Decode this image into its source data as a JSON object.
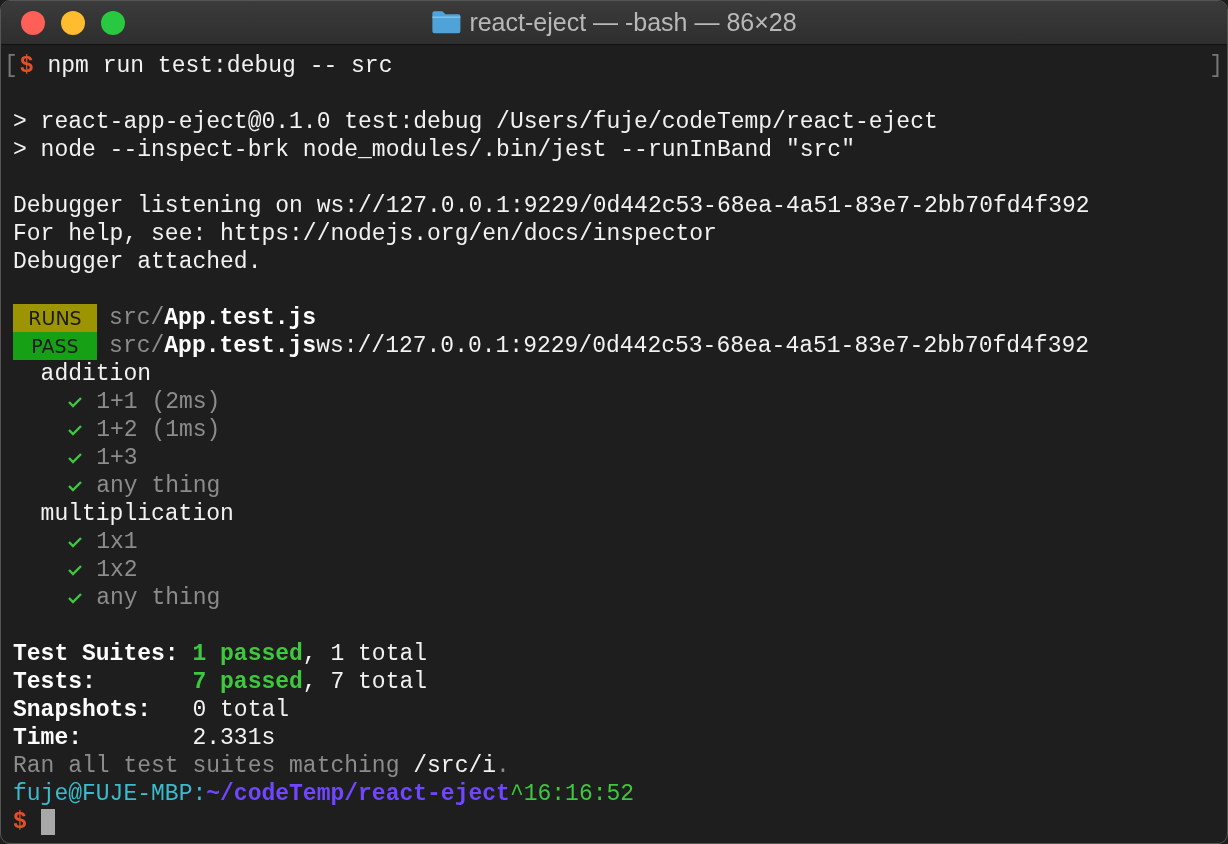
{
  "window": {
    "title": "react-eject — -bash — 86×28"
  },
  "terminal": {
    "lines": [
      {
        "kind": "text",
        "segments": [
          {
            "kind": "edge",
            "text": "["
          },
          {
            "kind": "prompt",
            "text": "$"
          },
          {
            "kind": "plain",
            "text": "npm run test:debug -- src"
          },
          {
            "kind": "edge-right",
            "text": "]"
          }
        ]
      },
      {
        "kind": "blank"
      },
      {
        "kind": "text",
        "segments": [
          {
            "kind": "plain",
            "text": "> react-app-eject@0.1.0 test:debug /Users/fuje/codeTemp/react-eject"
          }
        ]
      },
      {
        "kind": "text",
        "segments": [
          {
            "kind": "plain",
            "text": "> node --inspect-brk node_modules/.bin/jest --runInBand \"src\""
          }
        ]
      },
      {
        "kind": "blank"
      },
      {
        "kind": "text",
        "segments": [
          {
            "kind": "plain",
            "text": "Debugger listening on ws://127.0.0.1:9229/0d442c53-68ea-4a51-83e7-2bb70fd4f392"
          }
        ]
      },
      {
        "kind": "text",
        "segments": [
          {
            "kind": "plain",
            "text": "For help, see: https://nodejs.org/en/docs/inspector"
          }
        ]
      },
      {
        "kind": "text",
        "segments": [
          {
            "kind": "plain",
            "text": "Debugger attached."
          }
        ]
      },
      {
        "kind": "blank"
      },
      {
        "kind": "badge",
        "badge": "RUNS",
        "color": "#9c9400",
        "segments": [
          {
            "kind": "dim",
            "text": "src/"
          },
          {
            "kind": "bold",
            "text": "App.test.js"
          }
        ]
      },
      {
        "kind": "badge",
        "badge": "PASS",
        "color": "#16a016",
        "segments": [
          {
            "kind": "dim",
            "text": "src/"
          },
          {
            "kind": "bold",
            "text": "App.test.js"
          },
          {
            "kind": "plain",
            "text": "ws://127.0.0.1:9229/0d442c53-68ea-4a51-83e7-2bb70fd4f392"
          }
        ]
      },
      {
        "kind": "suite",
        "name": "addition",
        "tests": [
          {
            "name": "1+1 (2ms)",
            "passed": true
          },
          {
            "name": "1+2 (1ms)",
            "passed": true
          },
          {
            "name": "1+3",
            "passed": true
          },
          {
            "name": "any thing",
            "passed": true
          }
        ]
      },
      {
        "kind": "suite",
        "name": "multiplication",
        "tests": [
          {
            "name": "1x1",
            "passed": true
          },
          {
            "name": "1x2",
            "passed": true
          },
          {
            "name": "any thing",
            "passed": true
          }
        ]
      },
      {
        "kind": "blank"
      },
      {
        "kind": "summary",
        "label": "Test Suites:",
        "segments": [
          {
            "kind": "green-bold",
            "text": "1 passed"
          },
          {
            "kind": "plain",
            "text": ", 1 total"
          }
        ]
      },
      {
        "kind": "summary",
        "label": "Tests:",
        "segments": [
          {
            "kind": "green-bold",
            "text": "7 passed"
          },
          {
            "kind": "plain",
            "text": ", 7 total"
          }
        ]
      },
      {
        "kind": "summary",
        "label": "Snapshots:",
        "segments": [
          {
            "kind": "plain",
            "text": "0 total"
          }
        ]
      },
      {
        "kind": "summary",
        "label": "Time:",
        "segments": [
          {
            "kind": "plain",
            "text": "2.331s"
          }
        ]
      },
      {
        "kind": "text",
        "segments": [
          {
            "kind": "dim",
            "text": "Ran all test suites matching "
          },
          {
            "kind": "plain",
            "text": "/src/i"
          },
          {
            "kind": "dim",
            "text": "."
          }
        ]
      },
      {
        "kind": "text",
        "segments": [
          {
            "kind": "cyan",
            "text": "fuje@FUJE-MBP:"
          },
          {
            "kind": "path",
            "text": "~/codeTemp/react-eject"
          },
          {
            "kind": "time",
            "text": "^16:16:52"
          }
        ]
      },
      {
        "kind": "cursor",
        "segments": [
          {
            "kind": "prompt",
            "text": "$"
          }
        ]
      }
    ]
  }
}
